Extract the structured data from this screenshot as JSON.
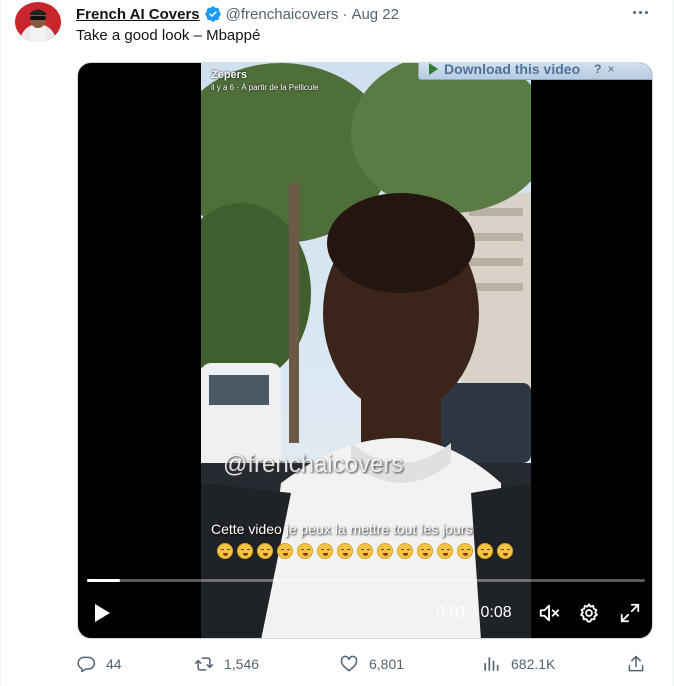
{
  "tweet": {
    "display_name": "French AI Covers",
    "handle": "@frenchaicovers",
    "separator": "·",
    "time": "Aug 22",
    "text": "Take a good look – Mbappé"
  },
  "video": {
    "download_label": "Download this video",
    "download_help": "?",
    "download_close": "×",
    "snap_title": "Zepers",
    "snap_subtitle": "il y a 6 · À partir de la Pellicule",
    "watermark": "@frenchaicovers",
    "caption": "Cette video je peux la mettre tout les jours",
    "emoji_count": 15,
    "progress": 0.06,
    "time_readout": "0:01 / 0:08"
  },
  "actions": {
    "replies": "44",
    "retweets": "1,546",
    "likes": "6,801",
    "views": "682.1K"
  },
  "colors": {
    "text": "#0f1419",
    "secondary": "#536471",
    "verified": "#1d9bf0"
  },
  "icons": {
    "more": "more-horizontal-icon",
    "verified": "verified-badge-icon",
    "play": "play-icon",
    "mute": "volume-muted-icon",
    "settings": "gear-icon",
    "fullscreen": "fullscreen-icon",
    "reply": "reply-icon",
    "retweet": "retweet-icon",
    "like": "heart-icon",
    "views": "views-bar-chart-icon",
    "share": "share-icon"
  }
}
